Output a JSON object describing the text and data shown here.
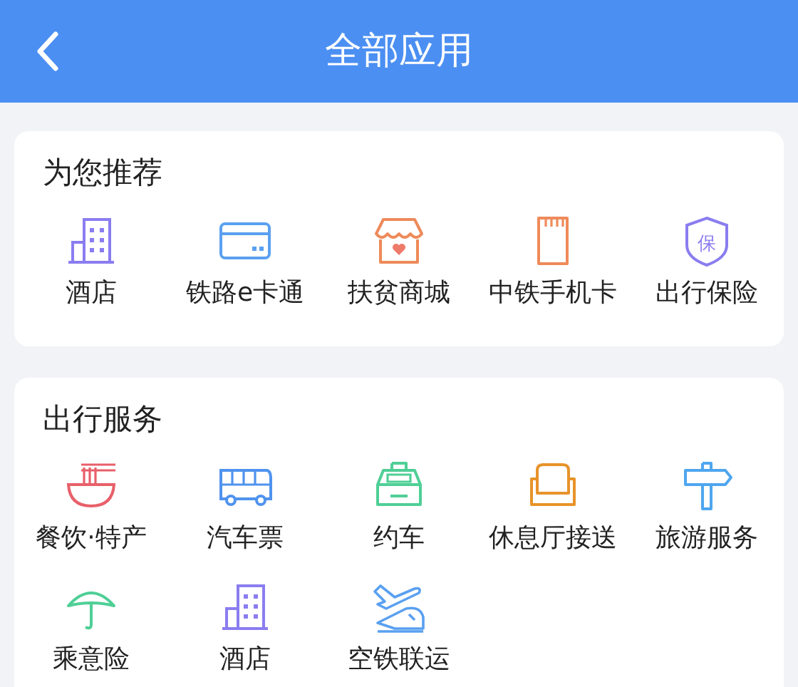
{
  "header": {
    "title": "全部应用"
  },
  "sections": [
    {
      "title": "为您推荐",
      "apps": [
        {
          "label": "酒店",
          "kind": "building"
        },
        {
          "label": "铁路e卡通",
          "kind": "card"
        },
        {
          "label": "扶贫商城",
          "kind": "shop"
        },
        {
          "label": "中铁手机卡",
          "kind": "sim"
        },
        {
          "label": "出行保险",
          "kind": "shield",
          "icon_text": "保"
        }
      ]
    },
    {
      "title": "出行服务",
      "apps": [
        {
          "label": "餐饮·特产",
          "kind": "noodles"
        },
        {
          "label": "汽车票",
          "kind": "bus"
        },
        {
          "label": "约车",
          "kind": "taxi"
        },
        {
          "label": "休息厅接送",
          "kind": "sofa"
        },
        {
          "label": "旅游服务",
          "kind": "signpost"
        },
        {
          "label": "乘意险",
          "kind": "umbrella"
        },
        {
          "label": "酒店",
          "kind": "building"
        },
        {
          "label": "空铁联运",
          "kind": "plane-train"
        }
      ]
    }
  ]
}
